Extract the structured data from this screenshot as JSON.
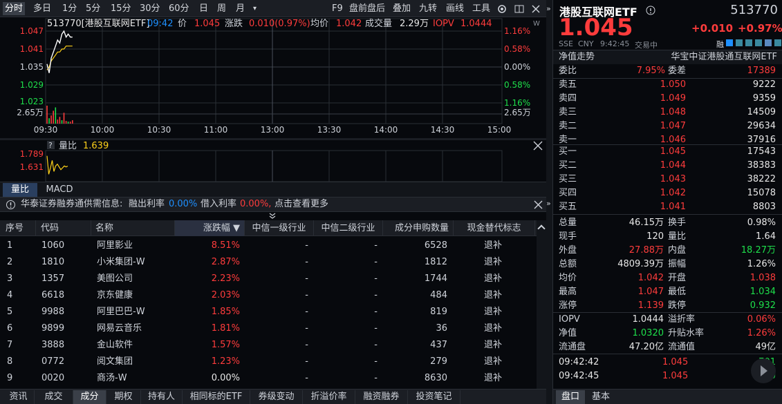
{
  "toolbar": {
    "items": [
      "分时",
      "多日",
      "1分",
      "5分",
      "15分",
      "30分",
      "60分",
      "日",
      "周",
      "月"
    ],
    "dropdown": "▾",
    "right_items": [
      "F9",
      "盘前盘后",
      "叠加",
      "九转",
      "画线",
      "工具"
    ]
  },
  "chart": {
    "code_name": "513770[港股互联网ETF]",
    "time": "09:42",
    "price_label": "价",
    "price": "1.045",
    "change_label": "涨跌",
    "change": "0.010(0.97%)",
    "avg_label": "均价",
    "avg": "1.042",
    "vol_label": "成交量",
    "vol": "2.29万",
    "iopv_label": "IOPV",
    "iopv": "1.0444",
    "price_ticks": [
      "1.047",
      "1.041",
      "1.035",
      "1.029",
      "1.023"
    ],
    "pct_ticks": [
      "1.16%",
      "0.58%",
      "0.00%",
      "0.58%",
      "1.16%"
    ],
    "vol_tick": "2.65万",
    "time_ticks": [
      "09:30",
      "10:00",
      "10:30",
      "11:00",
      "13:00",
      "13:30",
      "14:00",
      "14:30",
      "15:00"
    ],
    "corner": "W"
  },
  "chart_data": {
    "type": "line",
    "x": [
      "09:30",
      "09:31",
      "09:32",
      "09:33",
      "09:34",
      "09:35",
      "09:36",
      "09:37",
      "09:38",
      "09:39",
      "09:40",
      "09:41",
      "09:42"
    ],
    "series": [
      {
        "name": "价",
        "values": [
          1.036,
          1.033,
          1.038,
          1.04,
          1.042,
          1.044,
          1.043,
          1.046,
          1.047,
          1.045,
          1.046,
          1.045,
          1.045
        ]
      },
      {
        "name": "均价",
        "values": [
          1.034,
          1.035,
          1.037,
          1.038,
          1.039,
          1.04,
          1.04,
          1.041,
          1.041,
          1.042,
          1.042,
          1.042,
          1.042
        ]
      }
    ],
    "volume": [
      2.65,
      0.8,
      1.2,
      1.9,
      2.4,
      0.6,
      1.0,
      0.5,
      1.6,
      0.4,
      0.3,
      0.3,
      0.5
    ],
    "ylim": [
      1.023,
      1.047
    ]
  },
  "sub": {
    "label": "量比",
    "value": "1.639",
    "ticks": [
      "1.789",
      "1.631"
    ],
    "series": [
      1.75,
      1.55,
      1.62,
      1.7,
      1.58,
      1.64,
      1.66,
      1.63,
      1.6,
      1.62,
      1.64,
      1.63,
      1.639
    ]
  },
  "tabs": [
    "量比",
    "MACD"
  ],
  "info": {
    "prefix": "华泰证券融券通供需信息:",
    "a_label": "融出利率",
    "a_val": "0.00%",
    "b_label": "借入利率",
    "b_val": "0.00%,",
    "more": "点击查看更多"
  },
  "table": {
    "headers": [
      "序号",
      "代码",
      "名称",
      "涨跌幅 ▼",
      "中信一级行业",
      "中信二级行业",
      "成分申购数量",
      "现金替代标志"
    ],
    "rows": [
      [
        "1",
        "1060",
        "阿里影业",
        "8.51%",
        "-",
        "-",
        "6528",
        "退补"
      ],
      [
        "2",
        "1810",
        "小米集团-W",
        "2.87%",
        "-",
        "-",
        "1812",
        "退补"
      ],
      [
        "3",
        "1357",
        "美图公司",
        "2.23%",
        "-",
        "-",
        "1744",
        "退补"
      ],
      [
        "4",
        "6618",
        "京东健康",
        "2.03%",
        "-",
        "-",
        "484",
        "退补"
      ],
      [
        "5",
        "9988",
        "阿里巴巴-W",
        "1.85%",
        "-",
        "-",
        "819",
        "退补"
      ],
      [
        "6",
        "9899",
        "网易云音乐",
        "1.81%",
        "-",
        "-",
        "36",
        "退补"
      ],
      [
        "7",
        "3888",
        "金山软件",
        "1.57%",
        "-",
        "-",
        "437",
        "退补"
      ],
      [
        "8",
        "0772",
        "阅文集团",
        "1.23%",
        "-",
        "-",
        "279",
        "退补"
      ],
      [
        "9",
        "0020",
        "商汤-W",
        "0.00%",
        "-",
        "-",
        "8630",
        "退补"
      ]
    ]
  },
  "bottom_tabs": [
    "资讯",
    "成交",
    "成分",
    "期权",
    "持有人",
    "相同标的ETF",
    "券级变动",
    "折溢价率",
    "融资融券",
    "投资笔记"
  ],
  "quote": {
    "name": "港股互联网ETF",
    "code": "513770",
    "price": "1.045",
    "change": "+0.010",
    "change_pct": "+0.97%",
    "market": "SSE",
    "currency": "CNY",
    "time": "9:42:45",
    "status": "交易中",
    "rong": "融",
    "nav_trend": "净值走势",
    "fund_name": "华宝中证港股通互联网ETF",
    "weibi_label": "委比",
    "weibi": "7.95%",
    "weicha_label": "委差",
    "weicha": "17389",
    "asks": [
      [
        "卖五",
        "1.050",
        "9222"
      ],
      [
        "卖四",
        "1.049",
        "9359"
      ],
      [
        "卖三",
        "1.048",
        "14509"
      ],
      [
        "卖二",
        "1.047",
        "29634"
      ],
      [
        "卖一",
        "1.046",
        "37916"
      ]
    ],
    "bids": [
      [
        "买一",
        "1.045",
        "17543"
      ],
      [
        "买二",
        "1.044",
        "38383"
      ],
      [
        "买三",
        "1.043",
        "38222"
      ],
      [
        "买四",
        "1.042",
        "15078"
      ],
      [
        "买五",
        "1.041",
        "8803"
      ]
    ],
    "stats": [
      [
        "总量",
        "46.15万",
        "换手",
        "0.98%"
      ],
      [
        "现手",
        "120",
        "量比",
        "1.64"
      ],
      [
        "外盘",
        "27.88万",
        "内盘",
        "18.27万"
      ],
      [
        "总额",
        "4809.39万",
        "振幅",
        "1.26%"
      ],
      [
        "均价",
        "1.042",
        "开盘",
        "1.038"
      ],
      [
        "最高",
        "1.047",
        "最低",
        "1.034"
      ],
      [
        "涨停",
        "1.139",
        "跌停",
        "0.932"
      ]
    ],
    "stats2": [
      [
        "IOPV",
        "1.0444",
        "溢折率",
        "0.06%"
      ],
      [
        "净值",
        "1.0320",
        "升贴水率",
        "1.26%"
      ],
      [
        "流通盘",
        "47.20亿",
        "流通值",
        "49亿"
      ]
    ],
    "ticks": [
      [
        "09:42:42",
        "1.045",
        "701"
      ],
      [
        "09:42:45",
        "1.045",
        "120"
      ]
    ],
    "tabs": [
      "盘口",
      "基本"
    ]
  },
  "colors": {
    "up": "#ff3c3c",
    "down": "#1ee04b",
    "price_line": "#ffffff",
    "avg_line": "#ffd21a"
  }
}
